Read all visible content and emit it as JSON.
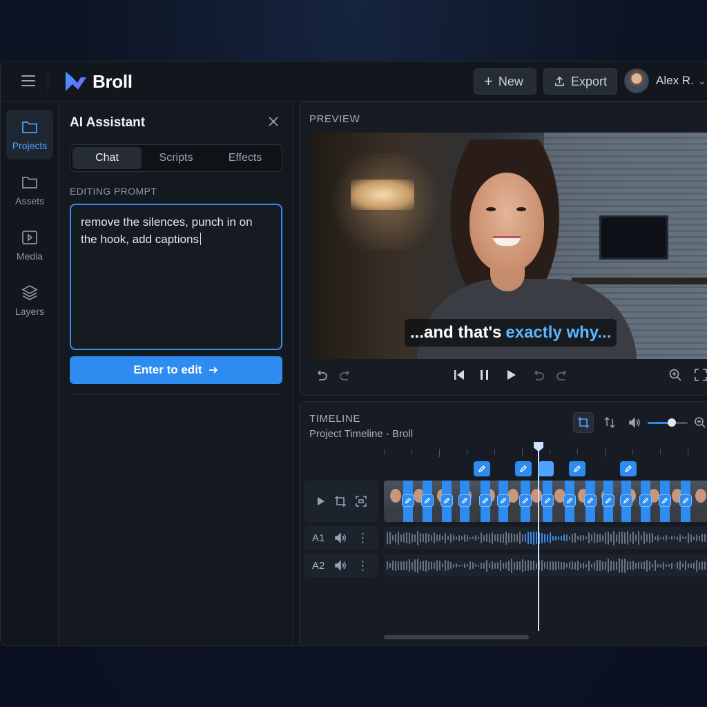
{
  "header": {
    "brand": "Broll",
    "new_label": "New",
    "export_label": "Export",
    "user_name": "Alex R."
  },
  "sidebar": {
    "items": [
      {
        "label": "Projects",
        "icon": "folder-icon",
        "active": true
      },
      {
        "label": "Assets",
        "icon": "folder-icon",
        "active": false
      },
      {
        "label": "Media",
        "icon": "media-icon",
        "active": false
      },
      {
        "label": "Layers",
        "icon": "layers-icon",
        "active": false
      }
    ]
  },
  "assistant": {
    "title": "AI Assistant",
    "tabs": [
      "Chat",
      "Scripts",
      "Effects"
    ],
    "active_tab": "Chat",
    "prompt_label": "EDITING PROMPT",
    "prompt_value": "remove the silences, punch in on the hook, add captions",
    "submit_label": "Enter to edit"
  },
  "preview": {
    "label": "PREVIEW",
    "caption_plain": "...and that's",
    "caption_highlight": "exactly why..."
  },
  "timeline": {
    "label": "TIMELINE",
    "subtitle": "Project Timeline - Broll",
    "volume_level": 0.6,
    "tracks": [
      {
        "id": "video"
      },
      {
        "id": "A1",
        "label": "A1"
      },
      {
        "id": "A2",
        "label": "A2"
      }
    ]
  },
  "colors": {
    "accent": "#2e8bf0",
    "caption_highlight": "#5db6ff",
    "background": "#12161d"
  }
}
